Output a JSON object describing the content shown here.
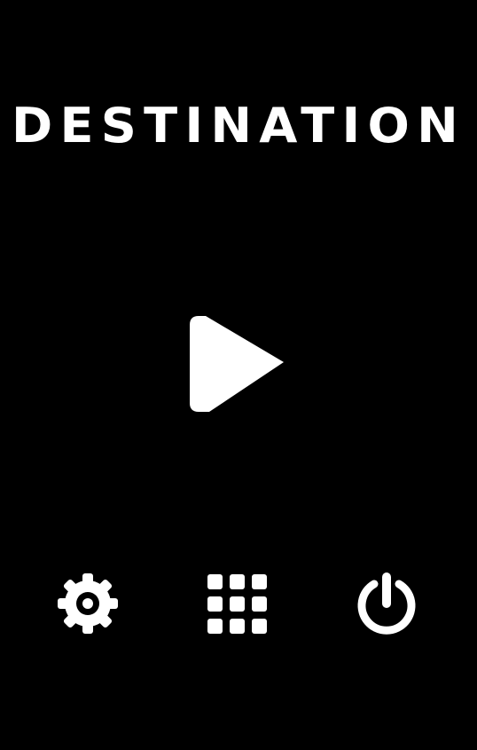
{
  "game": {
    "title": "DESTINATION"
  },
  "colors": {
    "background": "#000000",
    "foreground": "#ffffff"
  },
  "menu": {
    "play": "play-icon",
    "settings": "gear-icon",
    "levels": "grid-icon",
    "quit": "power-icon"
  }
}
